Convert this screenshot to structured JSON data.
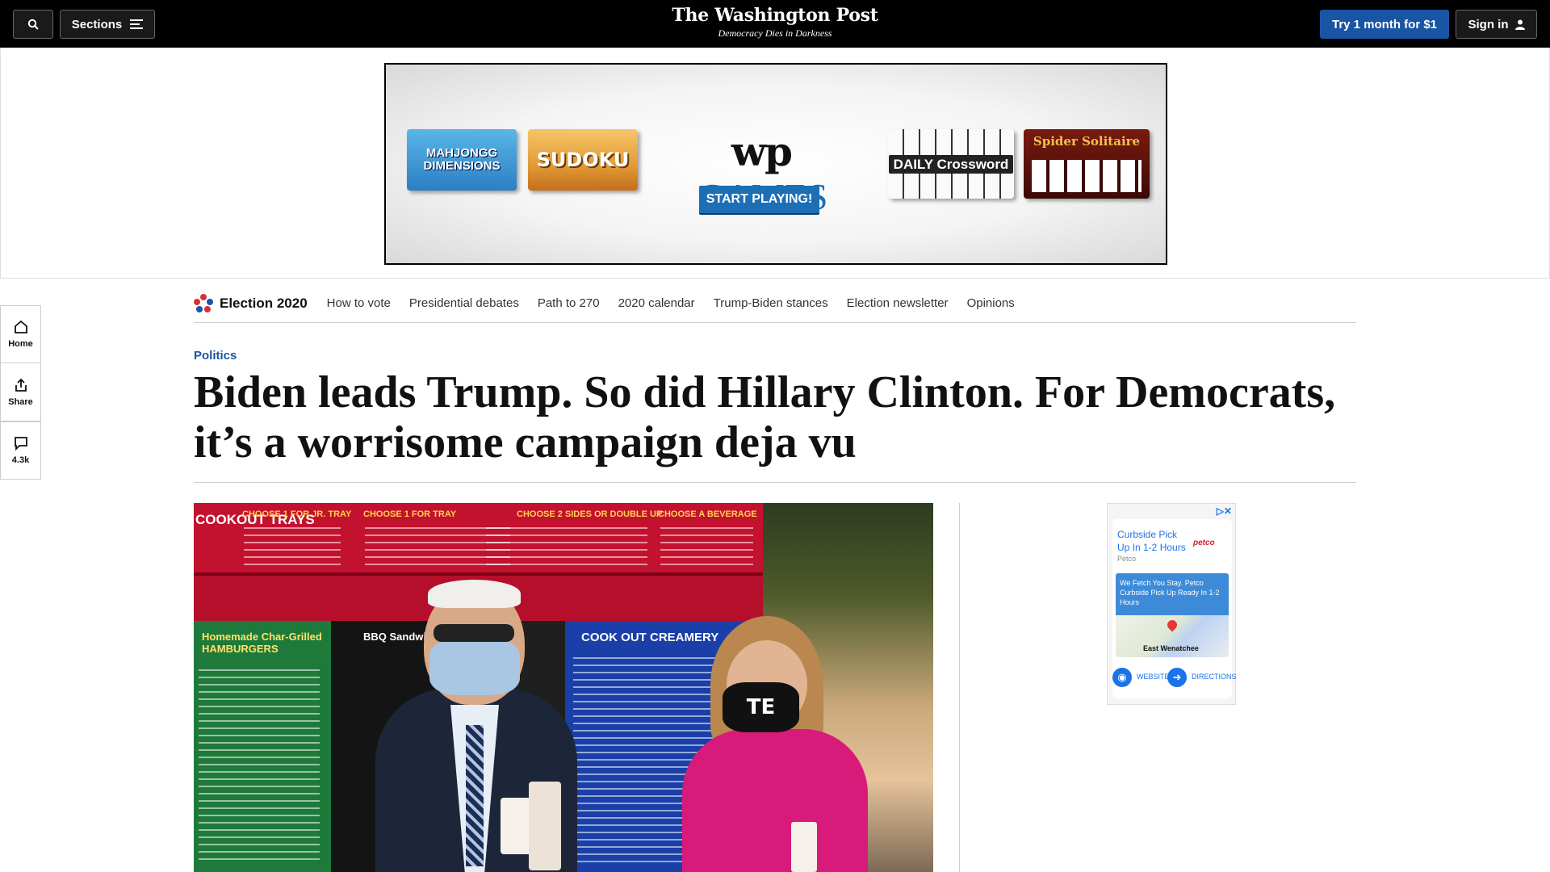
{
  "header": {
    "search_icon": "magnifier-icon",
    "sections_label": "Sections",
    "masthead_title": "The Washington Post",
    "masthead_tagline": "Democracy Dies in Darkness",
    "try_label": "Try 1 month for $1",
    "signin_label": "Sign in"
  },
  "ad_banner": {
    "tile_mahjong": "MAHJONGG DIMENSIONS",
    "tile_sudoku": "SUDOKU",
    "wp_logo": "wp",
    "wp_games": "GAMES",
    "start_label": "START PLAYING!",
    "tile_crossword": "DAILY Crossword",
    "tile_spider": "Spider Solitaire"
  },
  "rail": {
    "home_label": "Home",
    "share_label": "Share",
    "comments_count": "4.3k"
  },
  "election_nav": {
    "title": "Election 2020",
    "links": [
      "How to vote",
      "Presidential debates",
      "Path to 270",
      "2020 calendar",
      "Trump-Biden stances",
      "Election newsletter",
      "Opinions"
    ]
  },
  "article": {
    "kicker": "Politics",
    "headline": "Biden leads Trump. So did Hillary Clinton. For Democrats, it’s a worrisome campaign deja vu"
  },
  "photo": {
    "menu_top_1": "COOKOUT TRAYS",
    "menu_top_2": "CHOOSE 1 FOR JR. TRAY",
    "menu_top_3": "CHOOSE 1 FOR TRAY",
    "menu_top_4": "CHOOSE 2 SIDES OR DOUBLE UP",
    "menu_top_5": "CHOOSE A BEVERAGE",
    "menu_green": "Homemade Char-Grilled HAMBURGERS",
    "menu_blue": "COOK OUT CREAMERY",
    "menu_black": "BBQ Sandwich",
    "mask_text": "TE"
  },
  "side_ad": {
    "headline_1": "Curbside Pick",
    "headline_2": "Up In 1-2 Hours",
    "brand": "petco",
    "sub": "Petco",
    "blue_text": "We Fetch You Stay. Petco Curbside Pick Up Ready In 1-2 Hours",
    "map_label": "East Wenatchee",
    "website_label": "WEBSITE",
    "directions_label": "DIRECTIONS"
  },
  "colors": {
    "topbar": "#000000",
    "accent_blue": "#1955a5",
    "kicker": "#1955a5"
  }
}
